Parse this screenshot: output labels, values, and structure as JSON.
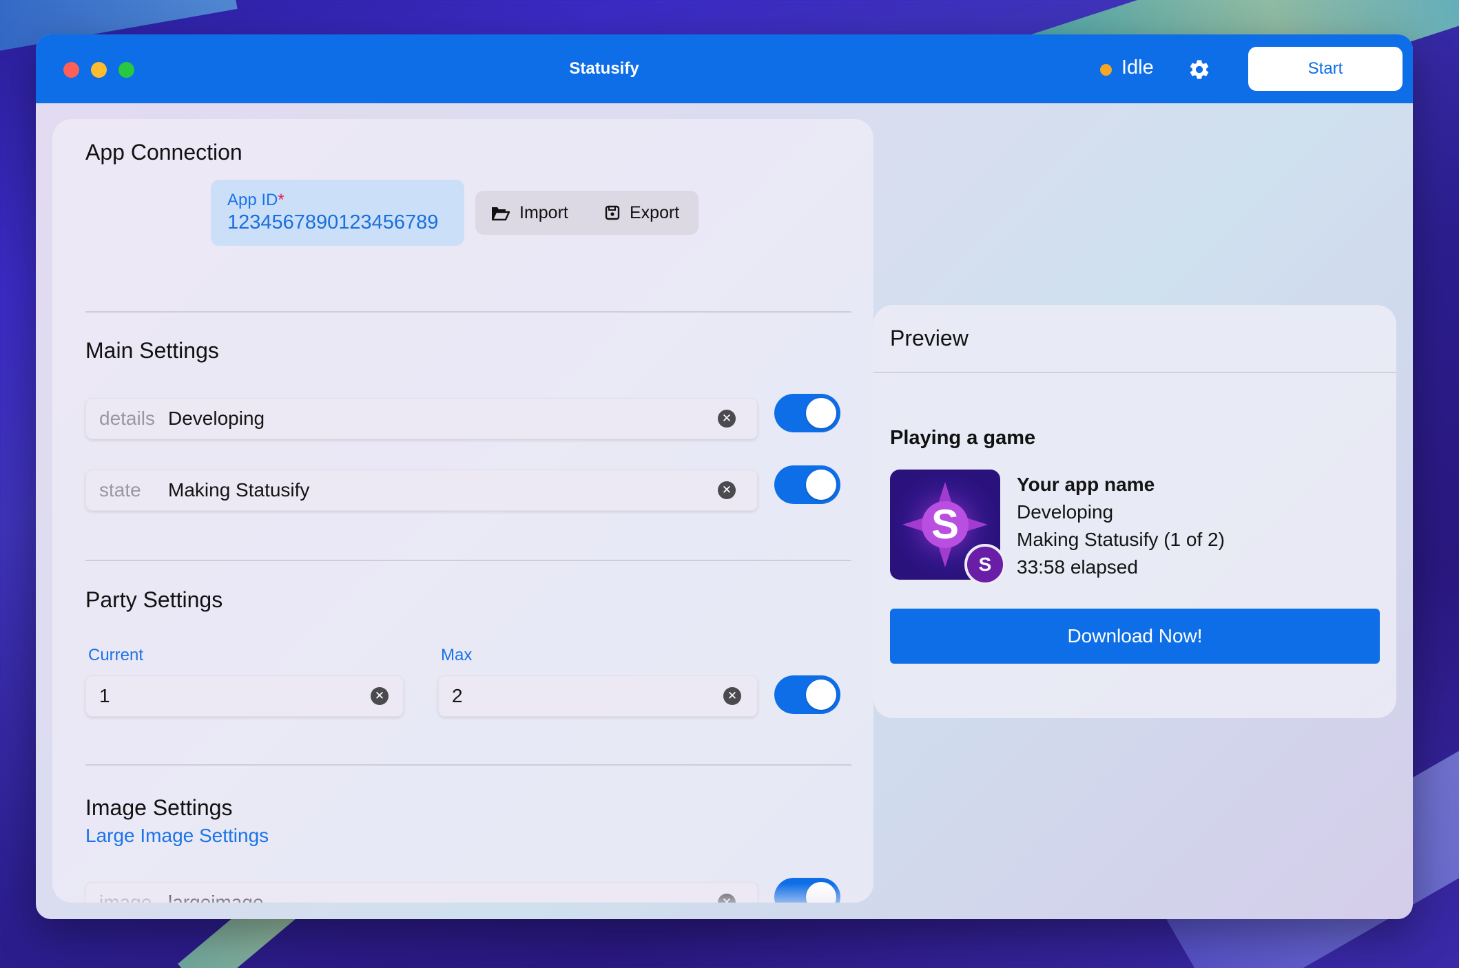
{
  "window": {
    "title": "Statusify",
    "status": "Idle",
    "start_label": "Start"
  },
  "app_connection": {
    "title": "App Connection",
    "app_id_label": "App ID",
    "required_mark": "*",
    "app_id_value": "1234567890123456789",
    "import_label": "Import",
    "export_label": "Export"
  },
  "main_settings": {
    "title": "Main Settings",
    "fields": [
      {
        "prefix": "details",
        "value": "Developing",
        "enabled": true
      },
      {
        "prefix": "state",
        "value": "Making Statusify",
        "enabled": true
      }
    ]
  },
  "party_settings": {
    "title": "Party Settings",
    "current_label": "Current",
    "current_value": "1",
    "max_label": "Max",
    "max_value": "2",
    "enabled": true
  },
  "image_settings": {
    "title": "Image Settings",
    "large_link": "Large Image Settings",
    "image_prefix": "image",
    "image_value": "largeimage",
    "enabled": true
  },
  "preview": {
    "title": "Preview",
    "activity_heading": "Playing a game",
    "icon_letter": "S",
    "app_name": "Your app name",
    "details": "Developing",
    "state": "Making Statusify (1 of 2)",
    "elapsed": "33:58 elapsed",
    "download_label": "Download Now!"
  },
  "colors": {
    "accent": "#0e6ee8",
    "status_idle": "#f5a623",
    "link": "#1a73e8",
    "required": "#e0245e"
  }
}
